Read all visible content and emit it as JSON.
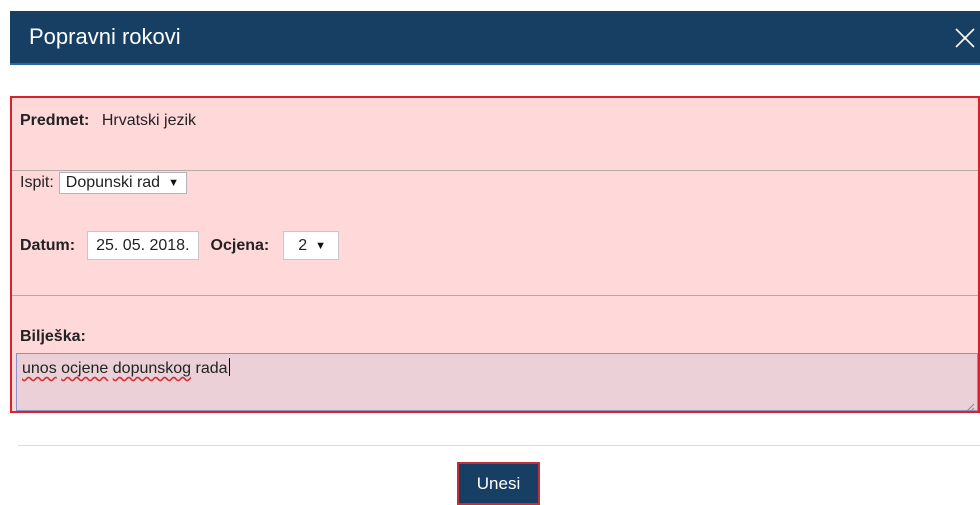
{
  "dialog": {
    "title": "Popravni rokovi",
    "close_icon": "close-icon"
  },
  "form": {
    "subject_label": "Predmet:",
    "subject_value": "Hrvatski jezik",
    "exam_label": "Ispit:",
    "exam_selected": "Dopunski rad",
    "date_label": "Datum:",
    "date_value": "25. 05. 2018.",
    "grade_label": "Ocjena:",
    "grade_selected": "2",
    "note_label": "Bilješka:",
    "note_words": [
      "unos",
      "ocjene",
      "dopunskog",
      "rada"
    ]
  },
  "actions": {
    "submit_label": "Unesi"
  },
  "colors": {
    "titlebar": "#173f63",
    "panel_background": "#ffd9d9",
    "highlight_border": "#d9222a"
  }
}
